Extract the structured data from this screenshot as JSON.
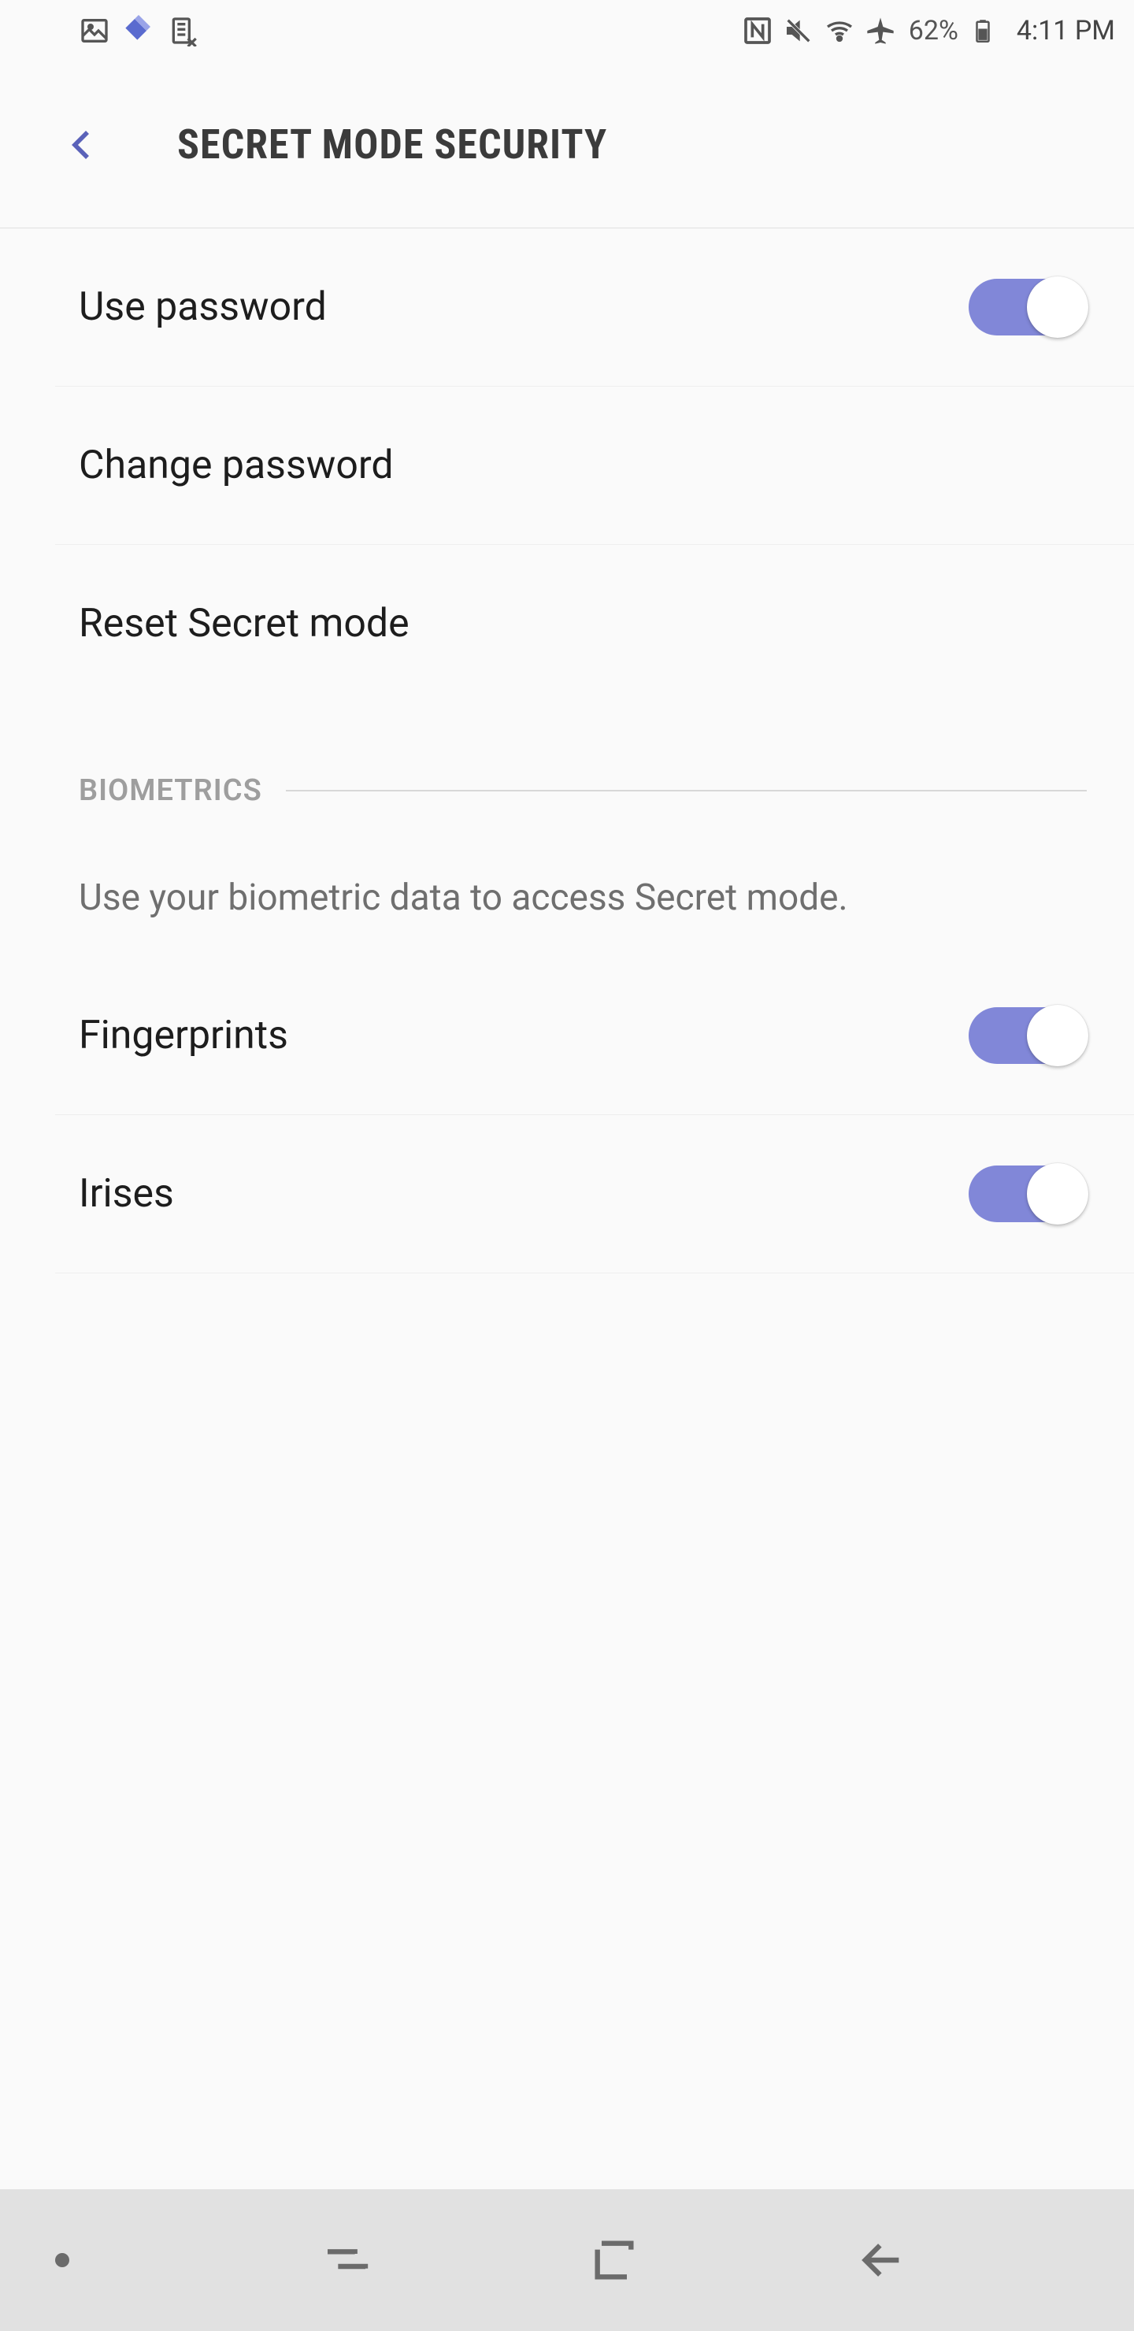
{
  "status_bar": {
    "battery_pct": "62%",
    "time": "4:11 PM"
  },
  "app_bar": {
    "title": "SECRET MODE SECURITY"
  },
  "settings": {
    "use_password": {
      "label": "Use password",
      "on": true
    },
    "change_password": {
      "label": "Change password"
    },
    "reset_secret_mode": {
      "label": "Reset Secret mode"
    }
  },
  "biometrics": {
    "header": "BIOMETRICS",
    "description": "Use your biometric data to access Secret mode.",
    "fingerprints": {
      "label": "Fingerprints",
      "on": true
    },
    "irises": {
      "label": "Irises",
      "on": true
    }
  }
}
